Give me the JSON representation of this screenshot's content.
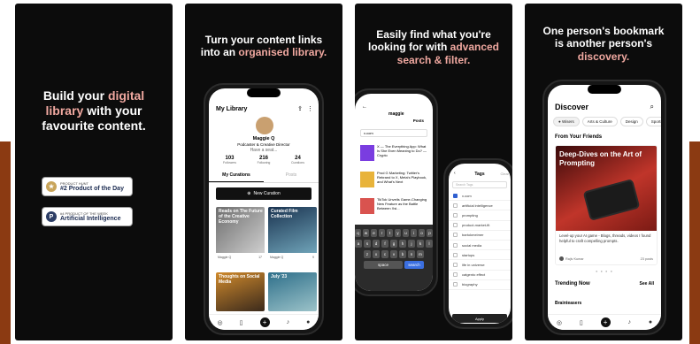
{
  "panel1": {
    "headline": [
      "Build your ",
      "digital",
      "library",
      " with your",
      "favourite content."
    ],
    "badge_ph": {
      "line1": "PRODUCT HUNT",
      "line2": "#2 Product of the Day"
    },
    "badge_week": {
      "line1": "#4 PRODUCT OF THE WEEK",
      "line2": "Artificial Intelligence"
    }
  },
  "panel2": {
    "headline_line1": "Turn your content links",
    "headline_pre": "into an ",
    "headline_accent": "organised library.",
    "screen_title": "My Library",
    "profile_name": "Maggie Q",
    "profile_role": "Podcaster & Creative Director",
    "profile_bio": "Have a seat...",
    "stats": [
      {
        "value": "103",
        "label": "Followers"
      },
      {
        "value": "216",
        "label": "Following"
      },
      {
        "value": "24",
        "label": "Curations"
      }
    ],
    "tab_active": "My Curations",
    "tab_other": "Posts",
    "new_button": "New Curation",
    "cards": [
      {
        "title": "Reads on The Future of the Creative Economy",
        "author": "Maggie Q",
        "count": "17"
      },
      {
        "title": "Curated Film Collection",
        "author": "Maggie Q",
        "count": "9"
      },
      {
        "title": "Thoughts on Social Media",
        "author": "",
        "count": ""
      },
      {
        "title": "July '23",
        "author": "",
        "count": ""
      }
    ]
  },
  "panel3": {
    "headline_line1": "Easily find what you're",
    "headline_pre": "looking for with ",
    "headline_accent1": "advanced",
    "headline_accent2": "search & filter.",
    "app_name": "maggie",
    "search_value": "x.com",
    "tab_posts": "Posts",
    "list": [
      "X — The Everything App: What Is She Even Meaning to Do? — Crypto",
      "Prod G Marketing: Twitter's Rebrand to X, Meta's Playbook, and What's Next",
      "TikTok Unveils Game-Changing New Feature as the Battle Between Xsi..."
    ],
    "keys_row1": [
      "q",
      "w",
      "e",
      "r",
      "t",
      "y",
      "u",
      "i",
      "o",
      "p"
    ],
    "keys_row2": [
      "a",
      "s",
      "d",
      "f",
      "g",
      "h",
      "j",
      "k",
      "l"
    ],
    "keys_row3": [
      "z",
      "x",
      "c",
      "v",
      "b",
      "n",
      "m"
    ],
    "key_space": "space",
    "key_search": "search",
    "tags_title": "Tags",
    "tags_clear": "Clear",
    "tags_search_placeholder": "Search Tags",
    "tags": [
      "x.com",
      "artificial intelligence",
      "prompting",
      "product-market-fit",
      "bartokmeimer",
      "social media",
      "startups",
      "life in universe",
      "catgento effect",
      "biography"
    ],
    "apply_button": "Apply"
  },
  "panel4": {
    "headline_line1": "One person's bookmark",
    "headline_line2": "is another person's",
    "headline_accent": "discovery.",
    "screen_title": "Discover",
    "chips": [
      "Wisers",
      "Arts & Culture",
      "Design",
      "Sports"
    ],
    "section_friends": "From Your Friends",
    "feature_title": "Deep-Dives on the Art of Prompting",
    "feature_desc": "Level-up your AI game - Blogs, threads, videos I found helpful to craft compelling prompts.",
    "feature_author": "Rajiv Kumar",
    "feature_count": "23 posts",
    "section_trending": "Trending Now",
    "see_all": "See All",
    "trending_item": "Brainteasers"
  }
}
